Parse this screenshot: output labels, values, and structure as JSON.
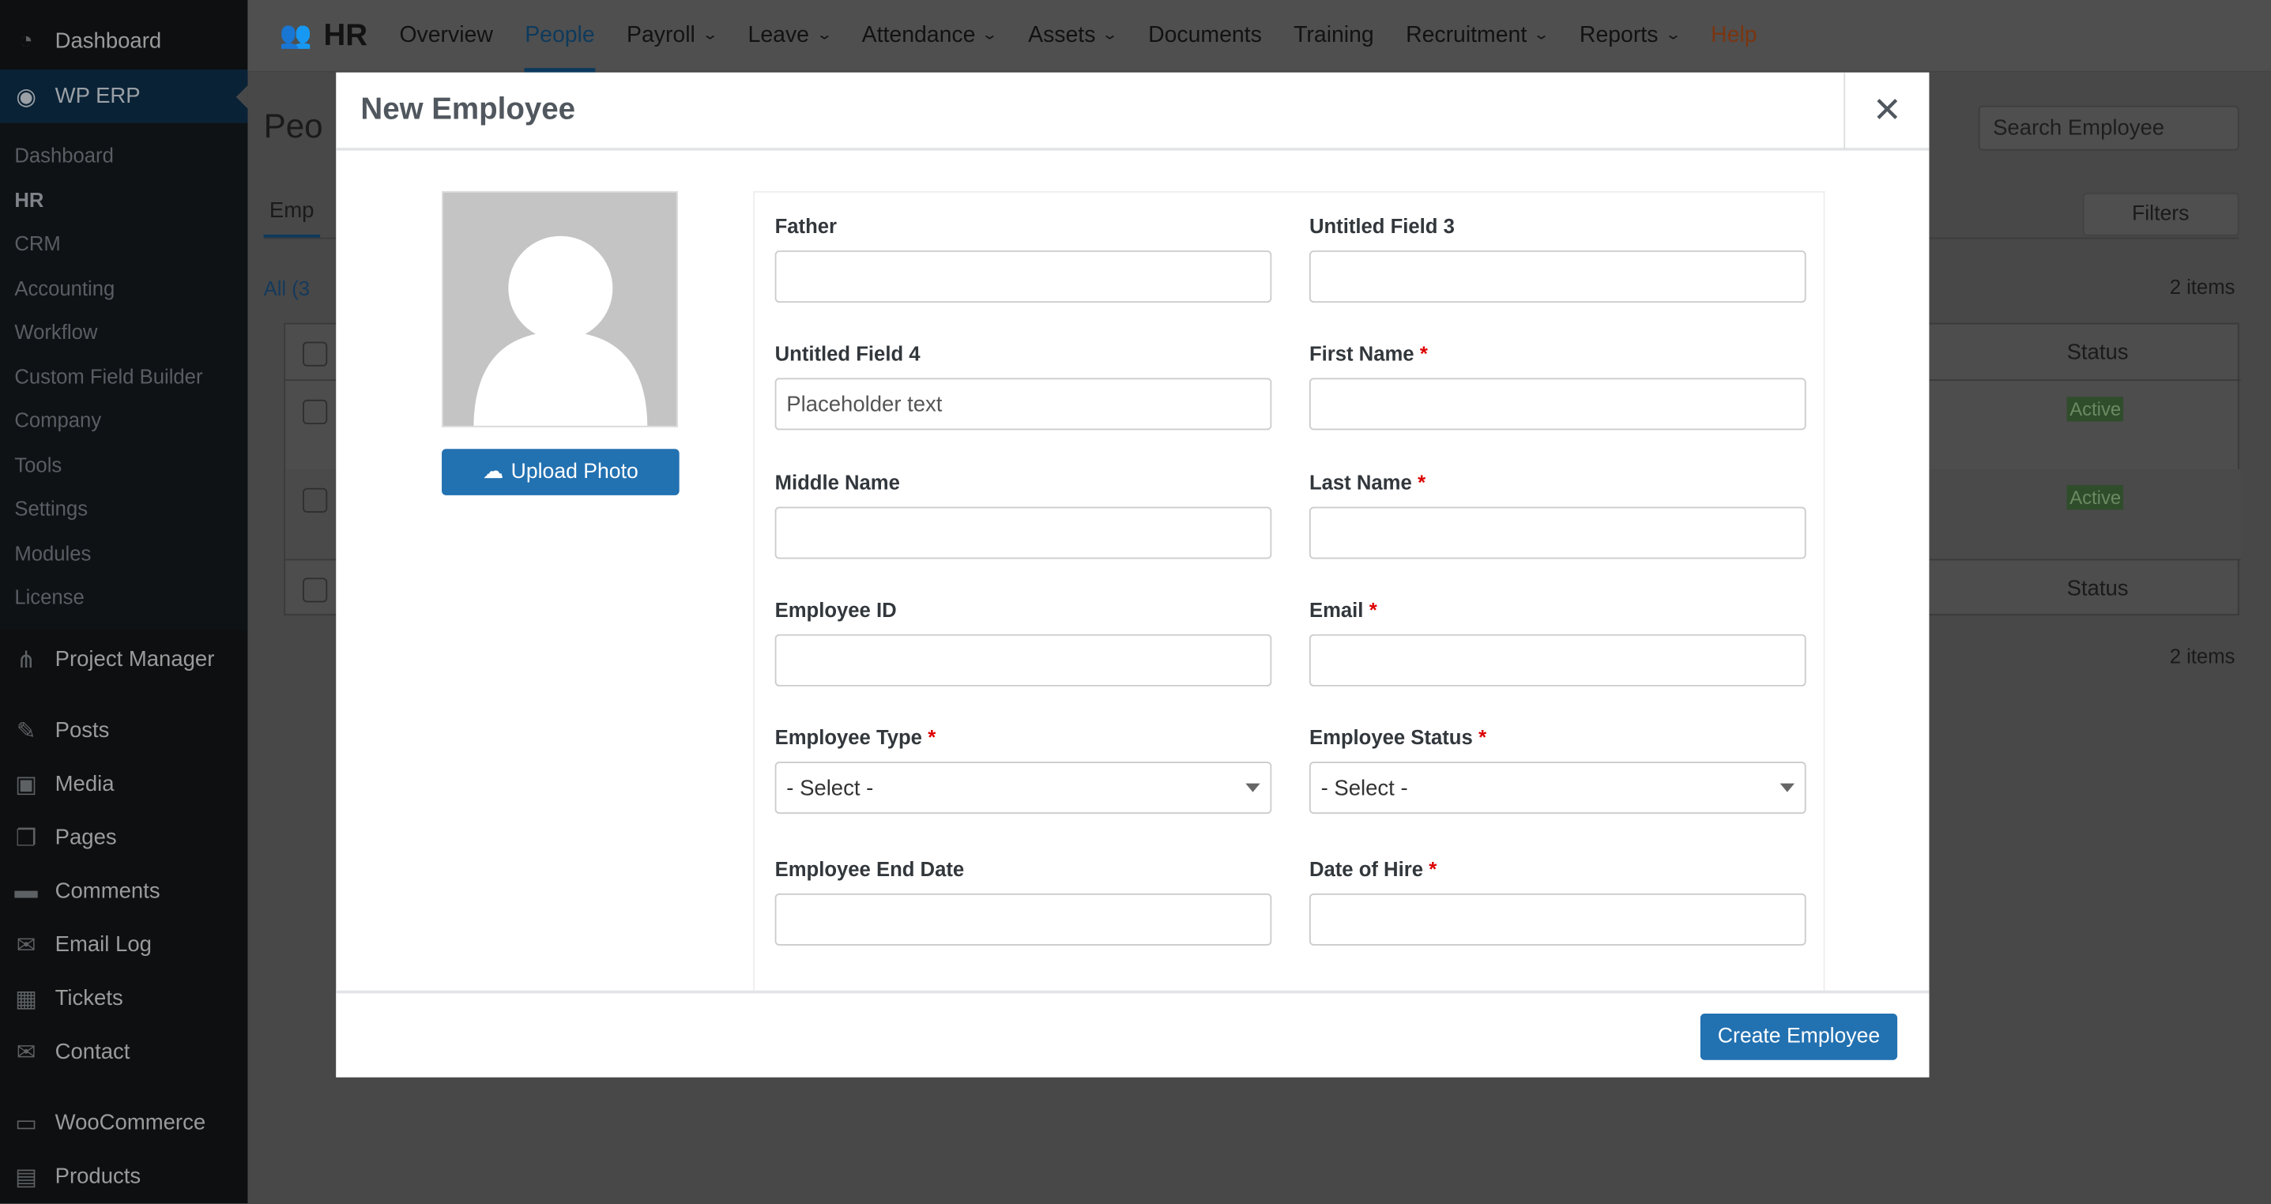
{
  "sidebar": {
    "top_item": "Dashboard",
    "active_plugin": "WP ERP",
    "sub_items": [
      "Dashboard",
      "HR",
      "CRM",
      "Accounting",
      "Workflow",
      "Custom Field Builder",
      "Company",
      "Tools",
      "Settings",
      "Modules",
      "License"
    ],
    "items": [
      {
        "label": "Project Manager",
        "icon": "project-manager-icon"
      },
      {
        "label": "Posts",
        "icon": "pin-icon"
      },
      {
        "label": "Media",
        "icon": "media-icon"
      },
      {
        "label": "Pages",
        "icon": "pages-icon"
      },
      {
        "label": "Comments",
        "icon": "comment-icon"
      },
      {
        "label": "Email Log",
        "icon": "mail-icon"
      },
      {
        "label": "Tickets",
        "icon": "grid-icon"
      },
      {
        "label": "Contact",
        "icon": "mail-icon"
      },
      {
        "label": "WooCommerce",
        "icon": "woo-icon"
      },
      {
        "label": "Products",
        "icon": "box-icon"
      }
    ]
  },
  "topnav": {
    "brand": "HR",
    "items": [
      {
        "label": "Overview",
        "dropdown": false
      },
      {
        "label": "People",
        "dropdown": false,
        "active": true
      },
      {
        "label": "Payroll",
        "dropdown": true
      },
      {
        "label": "Leave",
        "dropdown": true
      },
      {
        "label": "Attendance",
        "dropdown": true
      },
      {
        "label": "Assets",
        "dropdown": true
      },
      {
        "label": "Documents",
        "dropdown": false
      },
      {
        "label": "Training",
        "dropdown": false
      },
      {
        "label": "Recruitment",
        "dropdown": true
      },
      {
        "label": "Reports",
        "dropdown": true
      }
    ],
    "help": "Help",
    "help_color": "#d54e21"
  },
  "background": {
    "page_title": "Peo",
    "tab": "Emp",
    "filter_all": "All (3",
    "search_placeholder": "Search Employee",
    "filters": "Filters",
    "items_count": "2 items",
    "status_header": "Status",
    "status_badge": "Active"
  },
  "modal": {
    "title": "New Employee",
    "upload_photo": "Upload Photo",
    "create_button": "Create Employee",
    "fields": [
      {
        "label": "Father",
        "required": false,
        "value": "",
        "placeholder": ""
      },
      {
        "label": "Untitled Field 3",
        "required": false,
        "value": "",
        "placeholder": ""
      },
      {
        "label": "Untitled Field 4",
        "required": false,
        "value": "",
        "placeholder": "Placeholder text"
      },
      {
        "label": "First Name",
        "required": true,
        "value": "",
        "placeholder": ""
      },
      {
        "label": "Middle Name",
        "required": false,
        "value": "",
        "placeholder": ""
      },
      {
        "label": "Last Name",
        "required": true,
        "value": "",
        "placeholder": ""
      },
      {
        "label": "Employee ID",
        "required": false,
        "value": "",
        "placeholder": ""
      },
      {
        "label": "Email",
        "required": true,
        "value": "",
        "placeholder": ""
      },
      {
        "label": "Employee Type",
        "required": true,
        "type": "select",
        "value": "- Select -"
      },
      {
        "label": "Employee Status",
        "required": true,
        "type": "select",
        "value": "- Select -"
      },
      {
        "label": "Employee End Date",
        "required": false,
        "value": "",
        "placeholder": ""
      },
      {
        "label": "Date of Hire",
        "required": true,
        "value": "",
        "placeholder": ""
      }
    ],
    "required_mark": "*"
  },
  "colors": {
    "accent": "#2271b1",
    "sidebar": "#1d2327",
    "required": "#dd0000"
  }
}
